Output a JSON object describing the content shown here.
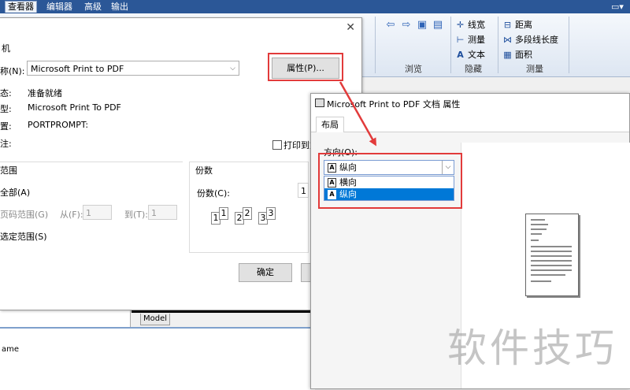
{
  "ribbon": {
    "tabs": [
      "查看器",
      "编辑器",
      "高级",
      "输出"
    ],
    "active_tab": "查看器",
    "buttons": {
      "line_width": "线宽",
      "measure": "测量",
      "text": "文本",
      "distance": "距离",
      "polyline_length": "多段线长度",
      "area": "面积"
    },
    "groups": {
      "browse": "浏览",
      "hide": "隐藏",
      "measure": "测量"
    }
  },
  "print_dialog": {
    "title_fragment": "机",
    "name_label": "称(N):",
    "printer_name": "Microsoft Print to PDF",
    "properties_button": "属性(P)...",
    "status_label": "态:",
    "status_value": "准备就绪",
    "type_label": "型:",
    "type_value": "Microsoft Print To PDF",
    "where_label": "置:",
    "where_value": "PORTPROMPT:",
    "comment_label": "注:",
    "print_to_file": "打印到文",
    "range_title": "范围",
    "range_all": "全部(A)",
    "range_pages": "页码范围(G)",
    "from_label": "从(F):",
    "from_value": "1",
    "to_label": "到(T):",
    "to_value": "1",
    "range_selection": "选定范围(S)",
    "copies_title": "份数",
    "copies_label": "份数(C):",
    "copies_value": "1",
    "collate_pages": [
      "1",
      "1",
      "2",
      "2",
      "3",
      "3"
    ],
    "ok_button": "确定"
  },
  "background": {
    "model_tab": "Model",
    "lower_text": "ame"
  },
  "properties_dialog": {
    "title": "Microsoft Print to PDF 文档 属性",
    "tab_layout": "布局",
    "orientation_label": "方向(O):",
    "orientation_value": "纵向",
    "option_landscape": "横向",
    "option_portrait": "纵向",
    "option_icon": "A"
  },
  "watermark": "软件技巧",
  "colors": {
    "annotation_red": "#e23b3b",
    "ribbon_blue": "#2b5797",
    "selection_blue": "#0078d7"
  }
}
